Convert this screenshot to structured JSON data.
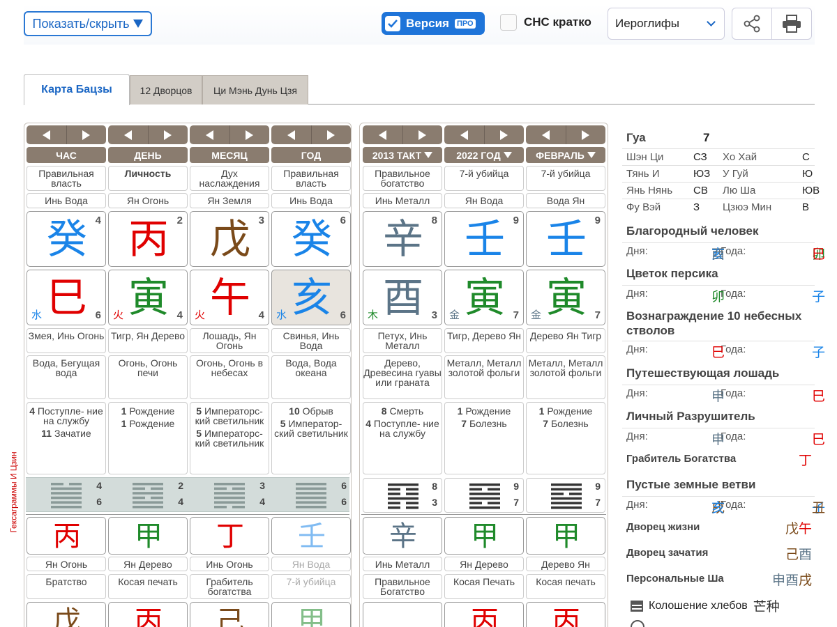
{
  "toolbar": {
    "toggle_label": "Показать/скрыть",
    "version_label": "Версия",
    "pro_badge": "ПРО",
    "sns_label": "СНС кратко",
    "script_select": "Иероглифы",
    "share_icon": "share-icon",
    "print_icon": "printer-icon"
  },
  "tabs": [
    "Карта Бацзы",
    "12 Дворцов",
    "Ци Мэнь Дунь Цзя"
  ],
  "side_label": "Гексаграммы И Цзин",
  "headers": {
    "hour": "ЧАС",
    "day": "ДЕНЬ",
    "month": "МЕСЯЦ",
    "year": "ГОД",
    "luck": "2013 ТАКТ",
    "annual": "2022 ГОД",
    "monthly": "ФЕВРАЛЬ"
  },
  "colors": {
    "fire": "#e00000",
    "water": "#1a84e8",
    "wood": "#1f8a2a",
    "earth": "#7a4a1a",
    "metal": "#5b7487",
    "panel": "#8a7c6f",
    "accent": "#1e74d9"
  },
  "pillars": [
    {
      "god": "Правильная власть",
      "stem_name": "Инь Вода",
      "stem": "癸",
      "stem_n": "4",
      "branch": "巳",
      "branch_n": "6",
      "el": "水",
      "animal": "Змея, Инь Огонь",
      "nayin": "Вода, Бегущая вода",
      "stages": [
        {
          "n": "4",
          "t": "Поступле- ние на службу"
        },
        {
          "n": "11",
          "t": "Зачатие"
        }
      ],
      "hex_top": "4",
      "hex_bot": "6",
      "h_stem": "丙",
      "h_stem_name": "Ян Огонь",
      "h_god": "Братство",
      "h_branch": "戊"
    },
    {
      "god": "Личность",
      "stem_name": "Ян Огонь",
      "stem": "丙",
      "stem_n": "2",
      "branch": "寅",
      "branch_n": "4",
      "el": "火",
      "animal": "Тигр, Ян Дерево",
      "nayin": "Огонь, Огонь печи",
      "stages": [
        {
          "n": "1",
          "t": "Рождение"
        },
        {
          "n": "1",
          "t": "Рождение"
        }
      ],
      "hex_top": "2",
      "hex_bot": "4",
      "h_stem": "甲",
      "h_stem_name": "Ян Дерево",
      "h_god": "Косая печать",
      "h_branch": "丙"
    },
    {
      "god": "Дух наслаждения",
      "stem_name": "Ян Земля",
      "stem": "戊",
      "stem_n": "3",
      "branch": "午",
      "branch_n": "4",
      "el": "火",
      "animal": "Лошадь, Ян Огонь",
      "nayin": "Огонь, Огонь в небесах",
      "stages": [
        {
          "n": "5",
          "t": "Императорс- кий светильник"
        },
        {
          "n": "5",
          "t": "Императорс- кий светильник"
        }
      ],
      "hex_top": "3",
      "hex_bot": "4",
      "h_stem": "丁",
      "h_stem_name": "Инь Огонь",
      "h_god": "Грабитель богатства",
      "h_branch": "己"
    },
    {
      "god": "Правильная власть",
      "stem_name": "Инь Вода",
      "stem": "癸",
      "stem_n": "6",
      "branch": "亥",
      "branch_n": "6",
      "el": "水",
      "animal": "Свинья, Инь Вода",
      "nayin": "Вода, Вода океана",
      "stages": [
        {
          "n": "10",
          "t": "Обрыв"
        },
        {
          "n": "5",
          "t": "Император- ский светильник"
        }
      ],
      "hex_top": "6",
      "hex_bot": "6",
      "h_stem": "壬",
      "h_stem_name": "Ян Вода",
      "h_god": "7-й убийца",
      "h_branch": "甲"
    },
    {
      "god": "Правильное богатство",
      "stem_name": "Инь Металл",
      "stem": "辛",
      "stem_n": "8",
      "branch": "酉",
      "branch_n": "3",
      "el": "木",
      "animal": "Петух, Инь Металл",
      "nayin": "Дерево, Древесина гуавы или граната",
      "stages": [
        {
          "n": "8",
          "t": "Смерть"
        },
        {
          "n": "4",
          "t": "Поступле- ние на службу"
        }
      ],
      "hex_top": "8",
      "hex_bot": "3",
      "h_stem": "辛",
      "h_stem_name": "Инь Металл",
      "h_god": "Правильное Богатство",
      "h_branch": ""
    },
    {
      "god": "7-й убийца",
      "stem_name": "Ян Вода",
      "stem": "壬",
      "stem_n": "9",
      "branch": "寅",
      "branch_n": "7",
      "el": "金",
      "animal": "Тигр, Дерево Ян",
      "nayin": "Металл, Металл золотой фольги",
      "stages": [
        {
          "n": "1",
          "t": "Рождение"
        },
        {
          "n": "7",
          "t": "Болезнь"
        }
      ],
      "hex_top": "9",
      "hex_bot": "7",
      "h_stem": "甲",
      "h_stem_name": "Ян Дерево",
      "h_god": "Косая Печать",
      "h_branch": "丙"
    },
    {
      "god": "7-й убийца",
      "stem_name": "Вода Ян",
      "stem": "壬",
      "stem_n": "9",
      "branch": "寅",
      "branch_n": "7",
      "el": "金",
      "animal": "Дерево Ян Тигр",
      "nayin": "Металл, Металл золотой фольги",
      "stages": [
        {
          "n": "1",
          "t": "Рождение"
        },
        {
          "n": "7",
          "t": "Болезнь"
        }
      ],
      "hex_top": "9",
      "hex_bot": "7",
      "h_stem": "甲",
      "h_stem_name": "Дерево Ян",
      "h_god": "Косая печать",
      "h_branch": "丙"
    }
  ],
  "right": {
    "gua_label": "Гуа",
    "gua_value": "7",
    "dirs": [
      [
        "Шэн Ци",
        "СЗ",
        "Хо Хай",
        "С"
      ],
      [
        "Тянь И",
        "ЮЗ",
        "У Гуй",
        "Ю"
      ],
      [
        "Янь Нянь",
        "СВ",
        "Лю Ша",
        "ЮВ"
      ],
      [
        "Фу Вэй",
        "З",
        "Цзюэ Мин",
        "В"
      ]
    ],
    "day_label": "Дня:",
    "year_label": "Года:",
    "sections": [
      {
        "title": "Благородный человек",
        "day": "亥酉",
        "year": "卯巳"
      },
      {
        "title": "Цветок персика",
        "day": "卯",
        "year": "子"
      },
      {
        "title": "Вознаграждение 10 небесных стволов",
        "day": "巳",
        "year": "子"
      },
      {
        "title": "Путешествующая лошадь",
        "day": "申",
        "year": "巳"
      },
      {
        "title": "Личный Разрушитель",
        "day": "申",
        "year": "巳"
      },
      {
        "title": "Пустые земные ветви",
        "day": "戌亥",
        "year": "子丑"
      }
    ],
    "robber_label": "Грабитель Богатства",
    "robber_value": "丁",
    "palaces": [
      {
        "label": "Дворец жизни",
        "value": "戊午"
      },
      {
        "label": "Дворец зачатия",
        "value": "己酉"
      },
      {
        "label": "Персональные Ша",
        "value": "申酉戌"
      }
    ],
    "solar_term": "Колошение хлебов",
    "solar_term_cn": "芒种"
  }
}
